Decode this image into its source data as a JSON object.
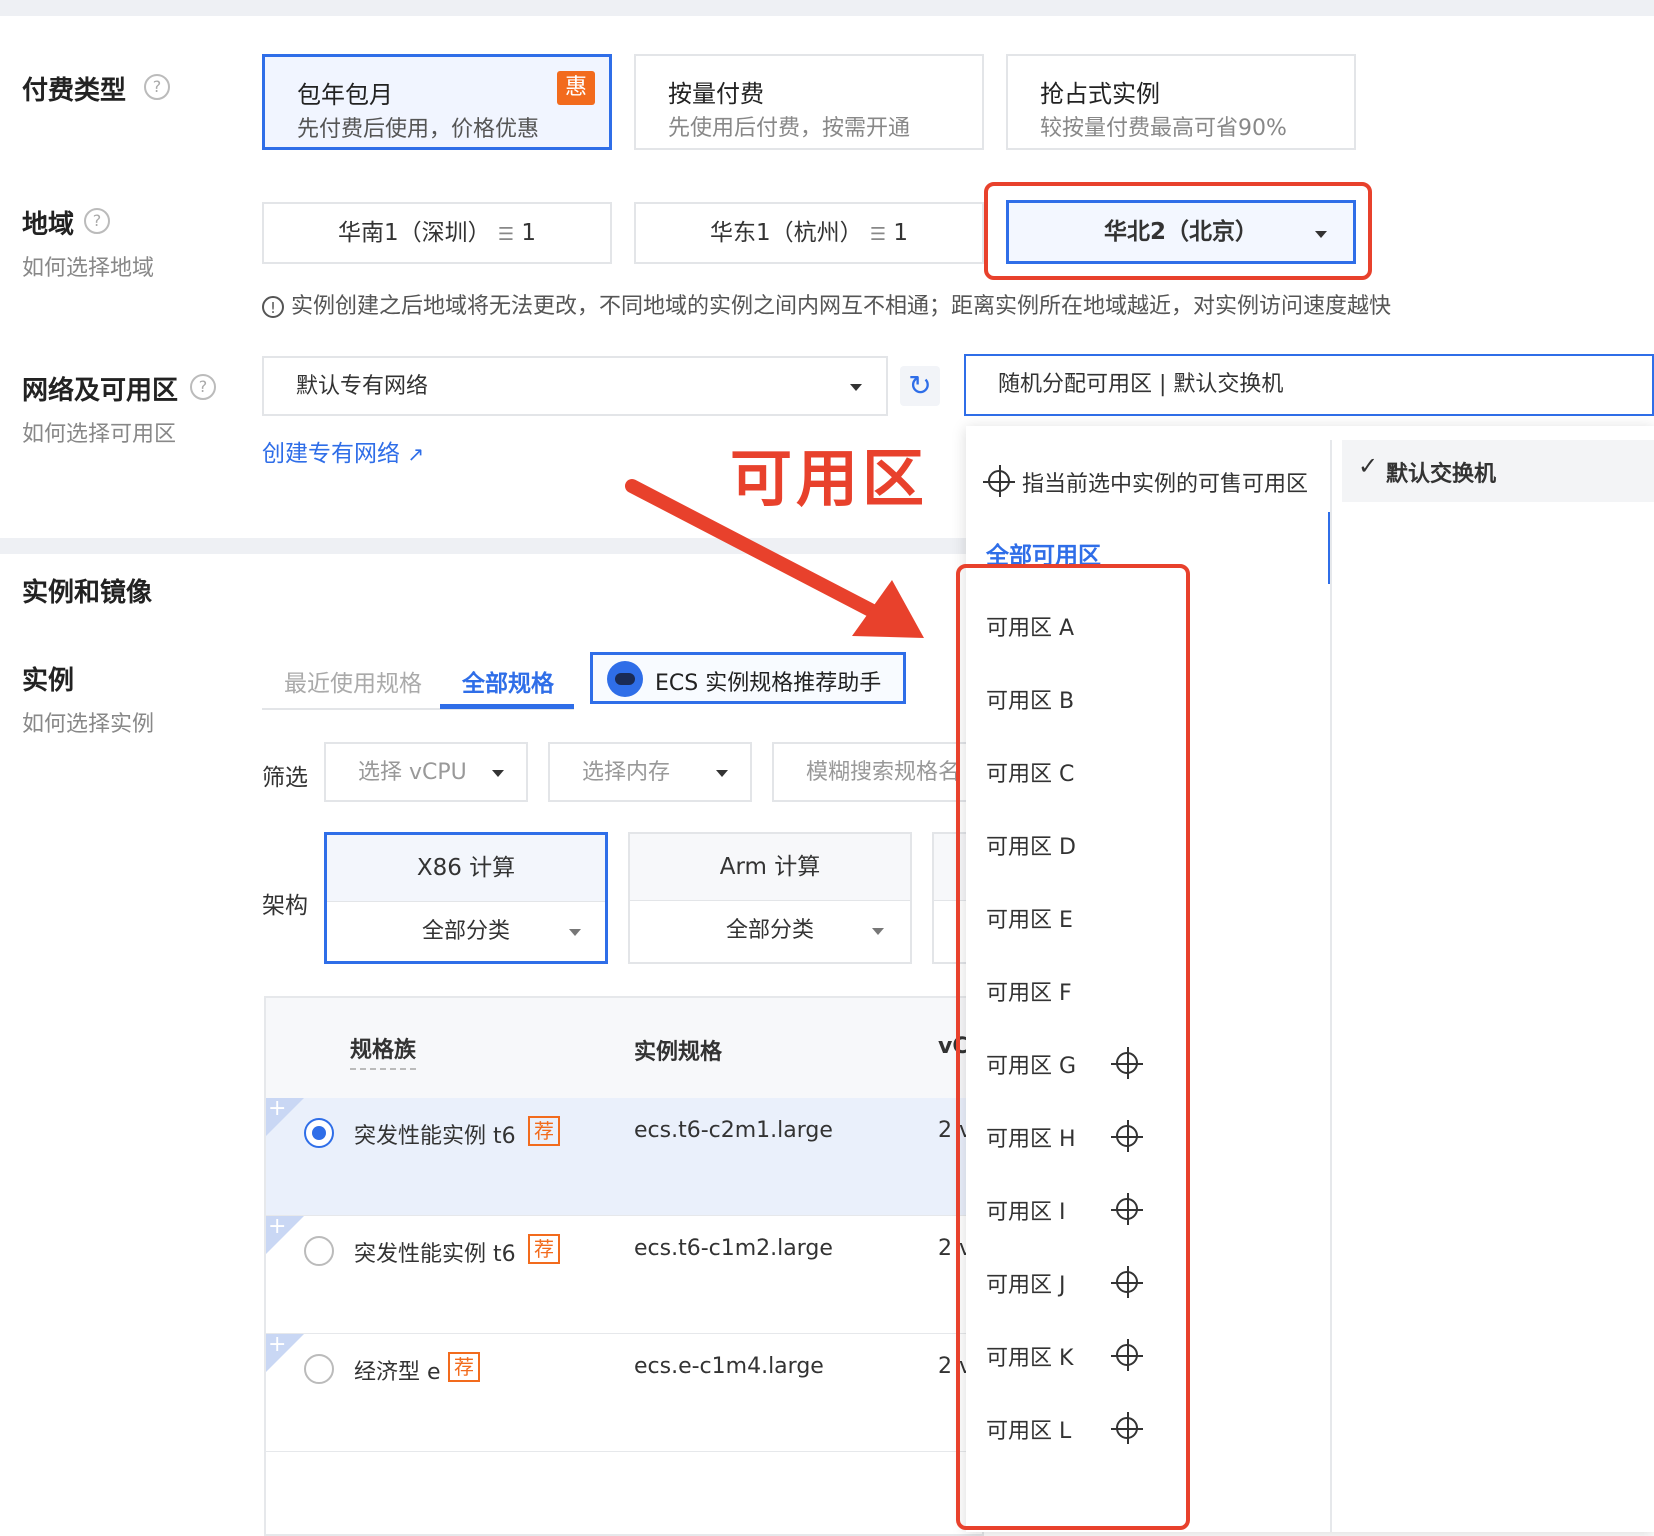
{
  "billing": {
    "label": "付费类型",
    "options": [
      {
        "title": "包年包月",
        "desc": "先付费后使用，价格优惠",
        "badge": "惠"
      },
      {
        "title": "按量付费",
        "desc": "先使用后付费，按需开通"
      },
      {
        "title": "抢占式实例",
        "desc": "较按量付费最高可省90%"
      }
    ]
  },
  "region": {
    "label": "地域",
    "help": "如何选择地域",
    "options": [
      {
        "name": "华南1（深圳）",
        "count": "1"
      },
      {
        "name": "华东1（杭州）",
        "count": "1"
      },
      {
        "name": "华北2（北京）"
      }
    ],
    "notice": "实例创建之后地域将无法更改，不同地域的实例之间内网互不相通；距离实例所在地域越近，对实例访问速度越快"
  },
  "network": {
    "label": "网络及可用区",
    "help": "如何选择可用区",
    "vpc_value": "默认专有网络",
    "create_link": "创建专有网络",
    "zone_value": "随机分配可用区 | 默认交换机"
  },
  "zone_dropdown": {
    "hint": "指当前选中实例的可售可用区",
    "all": "全部可用区",
    "zones": [
      "可用区 A",
      "可用区 B",
      "可用区 C",
      "可用区 D",
      "可用区 E",
      "可用区 F",
      "可用区 G",
      "可用区 H",
      "可用区 I",
      "可用区 J",
      "可用区 K",
      "可用区 L"
    ],
    "switch_option": "默认交换机"
  },
  "annotation": {
    "text": "可用区",
    "color": "#e8412c"
  },
  "instance_section": {
    "title": "实例和镜像",
    "label": "实例",
    "help": "如何选择实例",
    "tabs": [
      "最近使用规格",
      "全部规格"
    ],
    "assistant": "ECS 实例规格推荐助手",
    "filter_label": "筛选",
    "filters": [
      "选择 vCPU",
      "选择内存",
      "模糊搜索规格名"
    ],
    "arch_label": "架构",
    "arch": [
      {
        "name": "X86 计算",
        "category": "全部分类"
      },
      {
        "name": "Arm 计算",
        "category": "全部分类"
      }
    ],
    "table": {
      "headers": [
        "规格族",
        "实例规格",
        "vC"
      ],
      "rows": [
        {
          "family": "突发性能实例 t6",
          "tag": "荐",
          "spec": "ecs.t6-c2m1.large",
          "vcpu": "2 v",
          "selected": true
        },
        {
          "family": "突发性能实例 t6",
          "tag": "荐",
          "spec": "ecs.t6-c1m2.large",
          "vcpu": "2 v",
          "selected": false
        },
        {
          "family": "经济型 e",
          "tag": "荐",
          "spec": "ecs.e-c1m4.large",
          "vcpu": "2 v",
          "selected": false
        }
      ]
    }
  },
  "colors": {
    "accent": "#2f6ee8",
    "highlight": "#e8412c",
    "badge": "#f26b1d"
  }
}
